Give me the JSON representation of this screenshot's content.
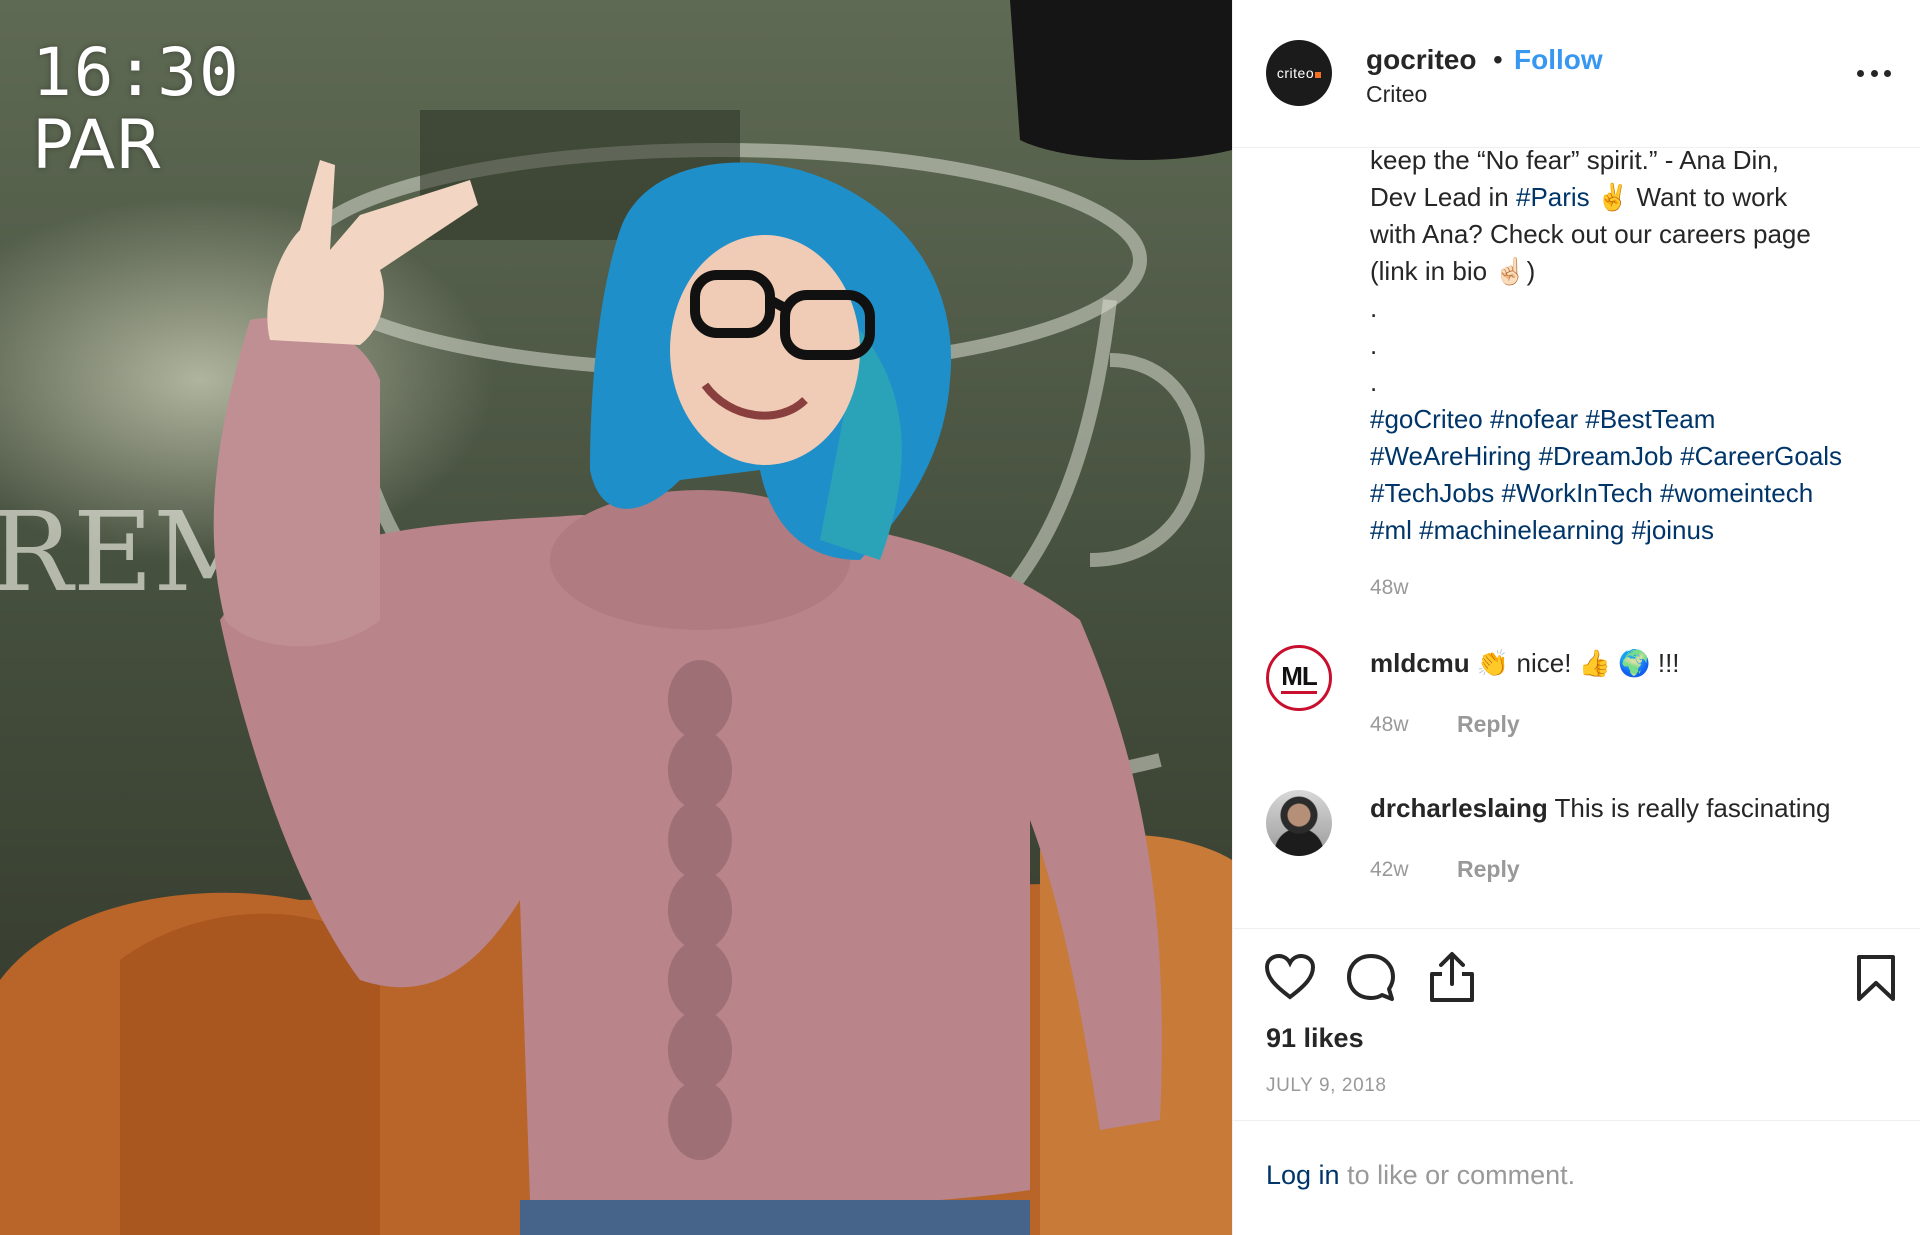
{
  "photo": {
    "time_overlay": "16:30",
    "city_overlay": "PAR",
    "wall_text": "REM"
  },
  "header": {
    "username": "gocriteo",
    "separator": "•",
    "follow_label": "Follow",
    "location": "Criteo",
    "avatar_text": "criteo"
  },
  "caption": {
    "line1": "keep the “No fear” spirit.” - Ana Din,",
    "line2_pre": "Dev Lead in ",
    "line2_tag": "#Paris",
    "line2_emoji": "✌️",
    "line2_post": " Want to work",
    "line3": "with Ana? Check out our careers page",
    "line4_pre": "(link in bio ",
    "line4_emoji": "☝🏻",
    "line4_post": ")",
    "dot": ".",
    "hashtags_line1": "#goCriteo #nofear #BestTeam",
    "hashtags_line2": "#WeAreHiring #DreamJob #CareerGoals",
    "hashtags_line3": "#TechJobs #WorkInTech #womeintech",
    "hashtags_line4": "#ml #machinelearning #joinus",
    "time": "48w"
  },
  "comments": [
    {
      "avatar_text": "ML",
      "username": "mldcmu",
      "text": "👏 nice! 👍 🌍 !!!",
      "time": "48w",
      "reply_label": "Reply"
    },
    {
      "username": "drcharleslaing",
      "text": "This is really fascinating",
      "time": "42w",
      "reply_label": "Reply"
    }
  ],
  "actions": {
    "like_icon": "heart-icon",
    "comment_icon": "comment-icon",
    "share_icon": "share-icon",
    "save_icon": "bookmark-icon"
  },
  "likes": "91 likes",
  "date": "JULY 9, 2018",
  "login": {
    "link": "Log in",
    "text": " to like or comment."
  },
  "colors": {
    "link": "#003569",
    "follow": "#3897f0",
    "muted": "#999999",
    "sweater": "#b9848a",
    "hair": "#1f8fc9"
  }
}
